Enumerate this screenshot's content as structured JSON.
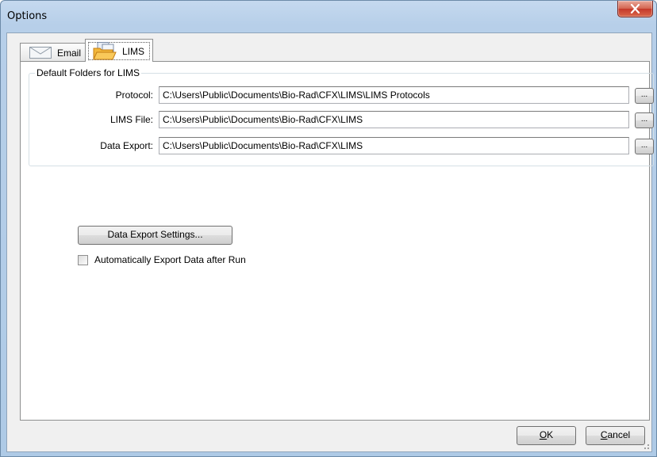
{
  "window": {
    "title": "Options"
  },
  "tabs": [
    {
      "label": "Email",
      "icon": "envelope-icon",
      "selected": false
    },
    {
      "label": "LIMS",
      "icon": "folder-icon",
      "selected": true
    }
  ],
  "group": {
    "title": "Default Folders for LIMS",
    "rows": [
      {
        "label": "Protocol:",
        "value": "C:\\Users\\Public\\Documents\\Bio-Rad\\CFX\\LIMS\\LIMS Protocols",
        "browse_label": "..."
      },
      {
        "label": "LIMS File:",
        "value": "C:\\Users\\Public\\Documents\\Bio-Rad\\CFX\\LIMS",
        "browse_label": "..."
      },
      {
        "label": "Data Export:",
        "value": "C:\\Users\\Public\\Documents\\Bio-Rad\\CFX\\LIMS",
        "browse_label": "..."
      }
    ]
  },
  "export_settings_label": "Data Export Settings...",
  "auto_export": {
    "label": "Automatically Export Data after Run",
    "checked": false
  },
  "footer": {
    "ok_label": "OK",
    "cancel_label": "Cancel"
  },
  "colors": {
    "frame": "#b7cfe9",
    "close": "#c4382a",
    "dialog_bg": "#f0f0f0"
  }
}
